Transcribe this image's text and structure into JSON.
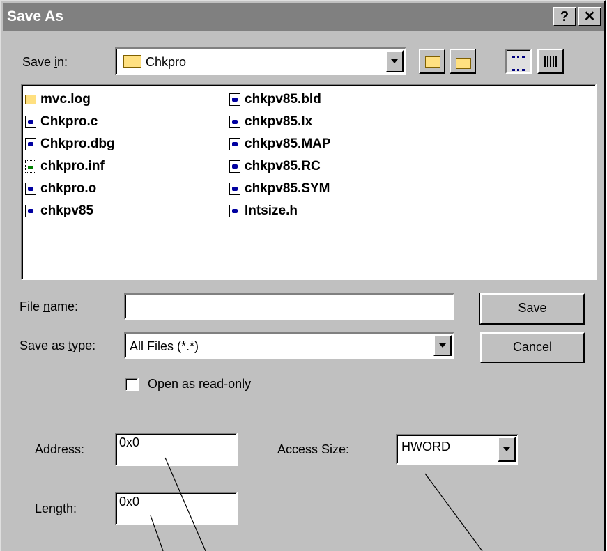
{
  "window": {
    "title": "Save As",
    "help_label": "?",
    "close_label": "✕"
  },
  "save_in": {
    "label_pre": "Save ",
    "label_key": "i",
    "label_post": "n:",
    "value": "Chkpro",
    "value_icon": "open-folder-icon",
    "toolbar_icons": [
      "up-one-level-icon",
      "new-folder-icon",
      "list-view-icon",
      "details-view-icon"
    ]
  },
  "files": {
    "col1": [
      {
        "name": "mvc.log",
        "icon": "folder-icon"
      },
      {
        "name": "Chkpro.c",
        "icon": "document-icon"
      },
      {
        "name": "Chkpro.dbg",
        "icon": "document-icon"
      },
      {
        "name": "chkpro.inf",
        "icon": "inf-file-icon"
      },
      {
        "name": "chkpro.o",
        "icon": "document-icon"
      },
      {
        "name": "chkpv85",
        "icon": "document-icon"
      }
    ],
    "col2": [
      {
        "name": "chkpv85.bld",
        "icon": "document-icon"
      },
      {
        "name": "chkpv85.lx",
        "icon": "document-icon"
      },
      {
        "name": "chkpv85.MAP",
        "icon": "document-icon"
      },
      {
        "name": "chkpv85.RC",
        "icon": "document-icon"
      },
      {
        "name": "chkpv85.SYM",
        "icon": "document-icon"
      },
      {
        "name": "Intsize.h",
        "icon": "document-icon"
      }
    ]
  },
  "file_name": {
    "label_pre": "File ",
    "label_key": "n",
    "label_post": "ame:",
    "value": ""
  },
  "save_type": {
    "label_pre": "Save as ",
    "label_key": "t",
    "label_post": "ype:",
    "value": "All Files (*.*)"
  },
  "buttons": {
    "save_key": "S",
    "save_rest": "ave",
    "cancel": "Cancel"
  },
  "read_only": {
    "label_pre": "Open as ",
    "label_key": "r",
    "label_post": "ead-only",
    "checked": false
  },
  "address": {
    "label": "Address:",
    "value": "0x0"
  },
  "access_size": {
    "label": "Access Size:",
    "value": "HWORD"
  },
  "length": {
    "label": "Length:",
    "value": "0x0"
  }
}
